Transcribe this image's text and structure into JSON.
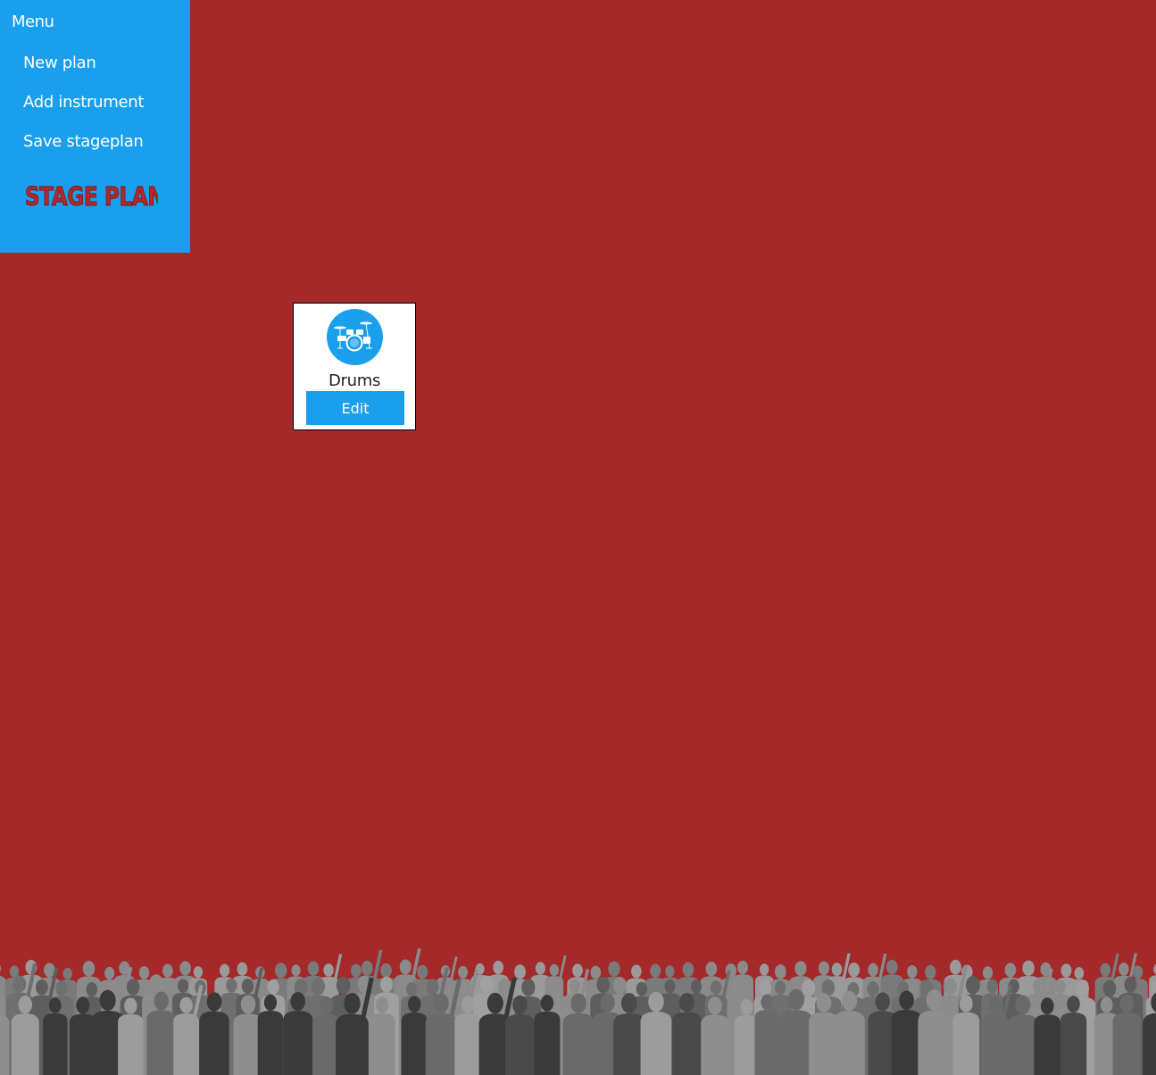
{
  "menu": {
    "title": "Menu",
    "items": [
      {
        "label": "New plan"
      },
      {
        "label": "Add instrument"
      },
      {
        "label": "Save stageplan"
      }
    ],
    "logo_text": "STAGE PLAN"
  },
  "instruments": [
    {
      "name": "Drums",
      "edit_label": "Edit",
      "icon": "drum-kit-icon"
    }
  ],
  "colors": {
    "background": "#a3292b",
    "accent": "#1a9fec",
    "logo": "#b5272b"
  }
}
